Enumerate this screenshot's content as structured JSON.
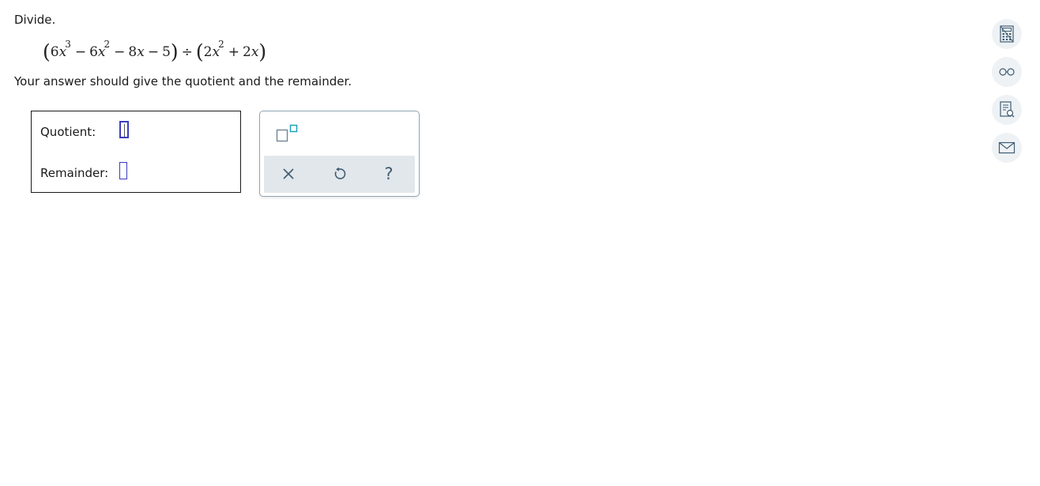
{
  "problem": {
    "instruction": "Divide.",
    "expression": {
      "dividend": [
        "6",
        "x",
        "3",
        "−",
        "6",
        "x",
        "2",
        "−",
        "8",
        "x",
        "−",
        "5"
      ],
      "divide_symbol": "÷",
      "divisor": [
        "2",
        "x",
        "2",
        "+",
        "2",
        "x"
      ]
    },
    "hint": "Your answer should give the quotient and the remainder."
  },
  "answer": {
    "quotient_label": "Quotient:",
    "quotient_value": "",
    "remainder_label": "Remainder:",
    "remainder_value": ""
  },
  "keypad": {
    "exponent_button": "exponent-template",
    "clear": "×",
    "undo": "undo",
    "help": "?"
  },
  "sidebar": {
    "items": [
      "calculator-icon",
      "glasses-icon",
      "reference-sheet-icon",
      "mail-icon"
    ]
  },
  "colors": {
    "blank_border": "#3b3bbf",
    "keypad_toolbar": "#e2e7ec",
    "icon": "#3f5d72",
    "exponent_accent": "#1aa3b8"
  }
}
